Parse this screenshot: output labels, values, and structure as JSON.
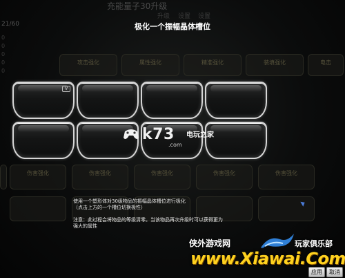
{
  "background": {
    "title": "充能量子30升级",
    "tabs": [
      "升级",
      "设置",
      "设置"
    ],
    "left_stat": "21/60",
    "left_values": [
      "0",
      "0",
      "0",
      "0",
      "0"
    ],
    "row1_labels": [
      "攻击强化",
      "属性强化",
      "精准强化",
      "装填强化",
      "电击"
    ],
    "row3_labels": [
      "伤害强化",
      "伤害强化",
      "伤害强化",
      "伤害强化",
      "伤害强化"
    ]
  },
  "dialog": {
    "title": "极化一个振幅晶体槽位",
    "slot_badge": "V",
    "instructions": {
      "line1": "使用一个塑形体对30级物品的振幅晶体槽位进行极化",
      "line2": "（点击上方的一个槽位切换极性）",
      "line3": "注意：此过程会将物品的等级清零。当该物品再次升级时可以获得更为",
      "line4": "强大的属性"
    },
    "buttons": {
      "apply": "应用",
      "cancel": "取消"
    }
  },
  "watermarks": {
    "k73_text": "k73",
    "k73_cn": "电玩之家",
    "k73_dot": ".com",
    "xiawai_left": "侠外游戏网",
    "xiawai_right": "玩家俱乐部",
    "xiawai_url": "www.Xiawai.Com"
  },
  "colors": {
    "slot_border": "#d6d6d6",
    "watermark_gold": "#ffd21f",
    "cursor_blue": "#4a7bd8"
  }
}
